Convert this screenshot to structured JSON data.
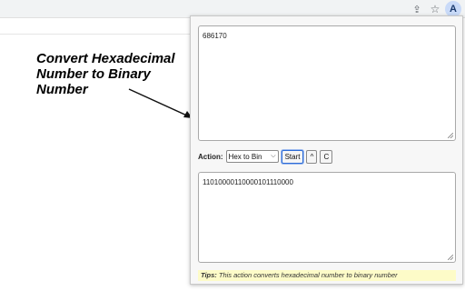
{
  "browser": {
    "profile_initial": "A",
    "icons": [
      "share-icon",
      "star-icon"
    ]
  },
  "annotation": {
    "text": "Convert Hexadecimal Number to Binary Number"
  },
  "popup": {
    "input_value": "686170",
    "action_label": "Action:",
    "selected_action": "Hex to Bin",
    "start_label": "Start",
    "up_label": "^",
    "clear_label": "C",
    "output_value": "11010000110000101110000",
    "tips_label": "Tips:",
    "tips_text": "This action converts hexadecimal number to binary number"
  },
  "colors": {
    "tips_background": "#fdfbc8",
    "start_button_border": "#2d6bd6"
  }
}
